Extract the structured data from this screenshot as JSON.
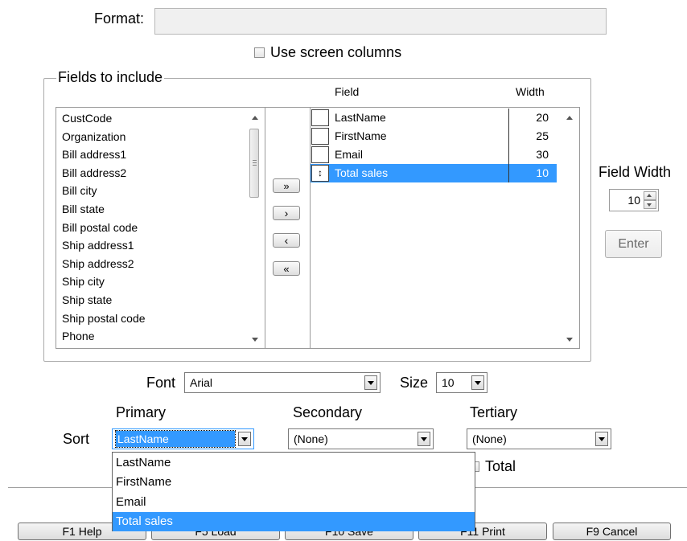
{
  "format": {
    "label": "Format:",
    "value": ""
  },
  "use_screen_columns": {
    "label": "Use screen columns",
    "checked": false
  },
  "fields_group": {
    "title": "Fields to include"
  },
  "available_fields": [
    "CustCode",
    "Organization",
    "Bill address1",
    "Bill address2",
    "Bill city",
    "Bill state",
    "Bill postal code",
    "Ship address1",
    "Ship address2",
    "Ship city",
    "Ship state",
    "Ship postal code",
    "Phone"
  ],
  "selected_grid": {
    "header_field": "Field",
    "header_width": "Width",
    "rows": [
      {
        "name": "LastName",
        "width": "20",
        "selected": false
      },
      {
        "name": "FirstName",
        "width": "25",
        "selected": false
      },
      {
        "name": "Email",
        "width": "30",
        "selected": false
      },
      {
        "name": "Total sales",
        "width": "10",
        "selected": true
      }
    ]
  },
  "move_buttons": {
    "add_all": "»",
    "add_one": "›",
    "remove_one": "‹",
    "remove_all": "«"
  },
  "field_width": {
    "label": "Field Width",
    "value": "10",
    "enter_label": "Enter"
  },
  "font": {
    "label": "Font",
    "value": "Arial"
  },
  "size": {
    "label": "Size",
    "value": "10"
  },
  "sort": {
    "label": "Sort",
    "primary_label": "Primary",
    "secondary_label": "Secondary",
    "tertiary_label": "Tertiary",
    "primary_value": "LastName",
    "secondary_value": "(None)",
    "tertiary_value": "(None)",
    "dropdown_options": [
      "LastName",
      "FirstName",
      "Email",
      "Total sales"
    ],
    "dropdown_highlight": "Total sales"
  },
  "total_checkbox": {
    "label": "Total",
    "checked": false
  },
  "footer": {
    "help": "F1 Help",
    "load": "F5 Load",
    "save": "F10 Save",
    "print": "F11 Print",
    "cancel": "F9 Cancel"
  },
  "colors": {
    "selection": "#3399ff",
    "panel_border": "#aaaaaa"
  }
}
